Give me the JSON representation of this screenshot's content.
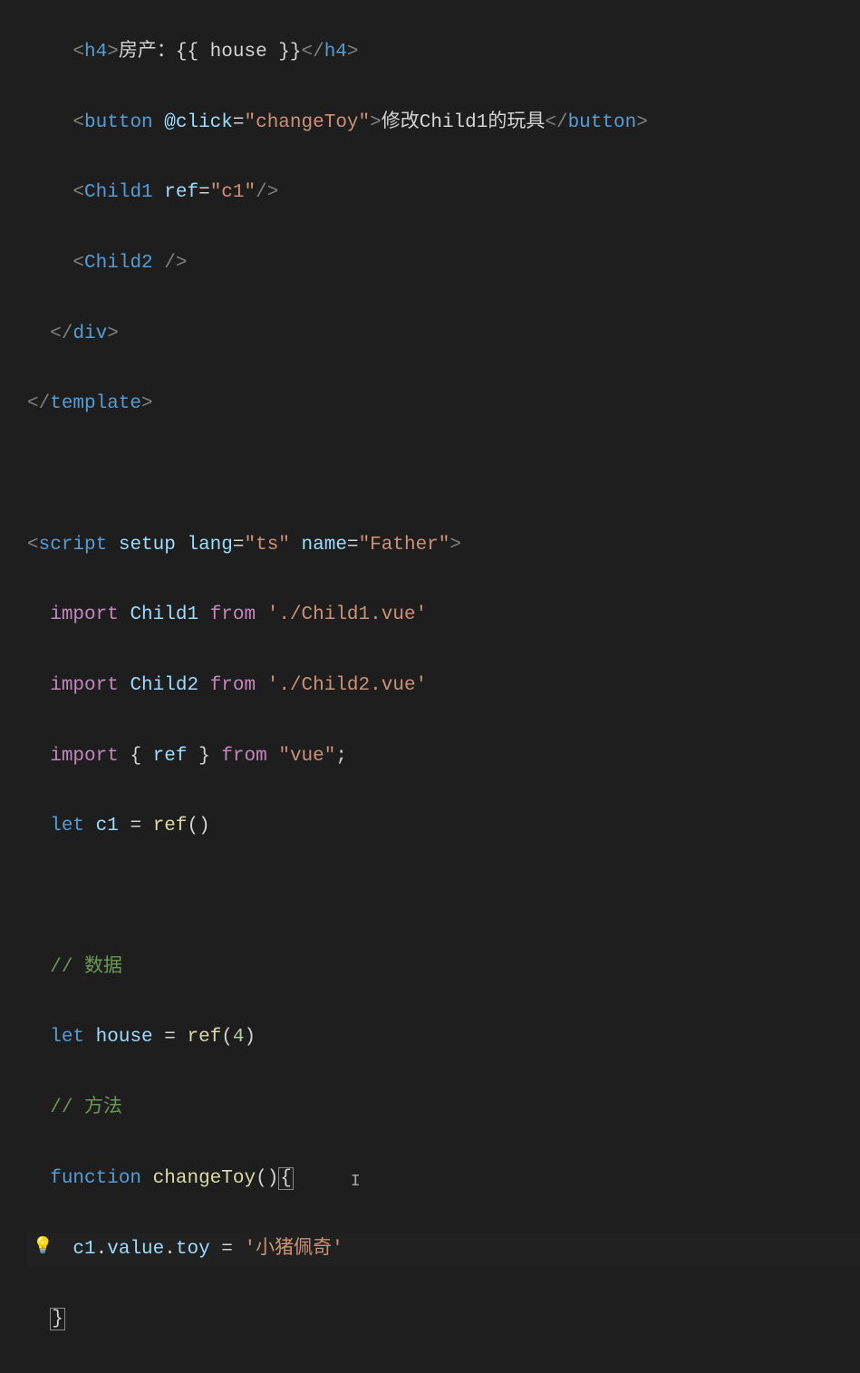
{
  "lines": {
    "l1_tag": "h4",
    "l1_text1": "房产：",
    "l1_mustache": "{{ house }}",
    "l2_tag": "button",
    "l2_attr": "@click",
    "l2_attrval": "\"changeToy\"",
    "l2_text": "修改Child1的玩具",
    "l3_tag": "Child1",
    "l3_attr": "ref",
    "l3_attrval": "\"c1\"",
    "l4_tag": "Child2",
    "l5_tag": "div",
    "l6_tag": "template",
    "l7_tag": "script",
    "l7_a1": "setup",
    "l7_a2": "lang",
    "l7_a2v": "\"ts\"",
    "l7_a3": "name",
    "l7_a3v": "\"Father\"",
    "l8_kw": "import",
    "l8_id": "Child1",
    "l8_from": "from",
    "l8_str": "'./Child1.vue'",
    "l9_kw": "import",
    "l9_id": "Child2",
    "l9_from": "from",
    "l9_str": "'./Child2.vue'",
    "l10_kw": "import",
    "l10_id": "ref",
    "l10_from": "from",
    "l10_str": "\"vue\"",
    "l11_let": "let",
    "l11_id": "c1",
    "l11_fn": "ref",
    "l12_comment": "// 数据",
    "l13_let": "let",
    "l13_id": "house",
    "l13_fn": "ref",
    "l13_num": "4",
    "l14_comment": "// 方法",
    "l15_kw": "function",
    "l15_fn": "changeToy",
    "l16_id1": "c1",
    "l16_id2": "value",
    "l16_id3": "toy",
    "l16_str": "'小猪佩奇'"
  },
  "icons": {
    "lightbulb": "lightbulb-icon"
  }
}
